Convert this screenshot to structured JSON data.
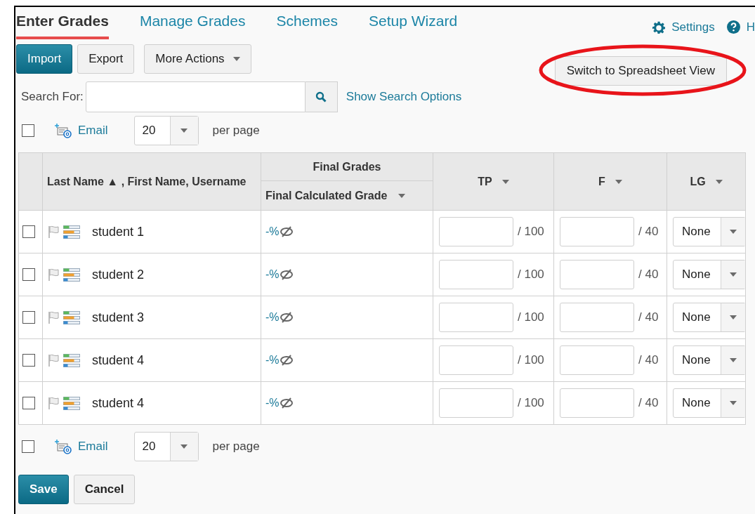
{
  "tabs": [
    {
      "label": "Enter Grades",
      "selected": true
    },
    {
      "label": "Manage Grades",
      "selected": false
    },
    {
      "label": "Schemes",
      "selected": false
    },
    {
      "label": "Setup Wizard",
      "selected": false
    }
  ],
  "top_links": [
    {
      "label": "Settings",
      "kind": "settings"
    },
    {
      "label": "H",
      "kind": "help"
    }
  ],
  "toolbar": [
    {
      "label": "Import",
      "kind": "primary"
    },
    {
      "label": "Export",
      "kind": "default"
    },
    {
      "label": "More Actions",
      "kind": "dropdown"
    }
  ],
  "switch_button": {
    "label": "Switch to Spreadsheet View",
    "circled": true
  },
  "search": {
    "label": "Search For:",
    "link": "Show Search Options"
  },
  "paging_top": {
    "checked": false,
    "email": "Email",
    "per_page_value": "20",
    "per_page_label": "per page"
  },
  "table": {
    "name_header": "Last Name ▲ , First Name, Username",
    "group_header": "Final Grades",
    "grade_header": "Final Calculated Grade",
    "columns": [
      {
        "label": "TP"
      },
      {
        "label": "F"
      },
      {
        "label": "LG"
      }
    ],
    "rows": [
      {
        "checked": false,
        "name": "student 1",
        "final_grade": "-%",
        "tp_max": "/ 100",
        "f_max": "/ 40",
        "lg": "None"
      },
      {
        "checked": false,
        "name": "student 2",
        "final_grade": "-%",
        "tp_max": "/ 100",
        "f_max": "/ 40",
        "lg": "None"
      },
      {
        "checked": false,
        "name": "student 3",
        "final_grade": "-%",
        "tp_max": "/ 100",
        "f_max": "/ 40",
        "lg": "None"
      },
      {
        "checked": false,
        "name": "student 4",
        "final_grade": "-%",
        "tp_max": "/ 100",
        "f_max": "/ 40",
        "lg": "None"
      },
      {
        "checked": false,
        "name": "student 4",
        "final_grade": "-%",
        "tp_max": "/ 100",
        "f_max": "/ 40",
        "lg": "None"
      }
    ]
  },
  "paging_bottom": {
    "checked": false,
    "email": "Email",
    "per_page_value": "20",
    "per_page_label": "per page"
  },
  "actions": [
    {
      "label": "Save",
      "kind": "primary"
    },
    {
      "label": "Cancel",
      "kind": "default"
    }
  ]
}
